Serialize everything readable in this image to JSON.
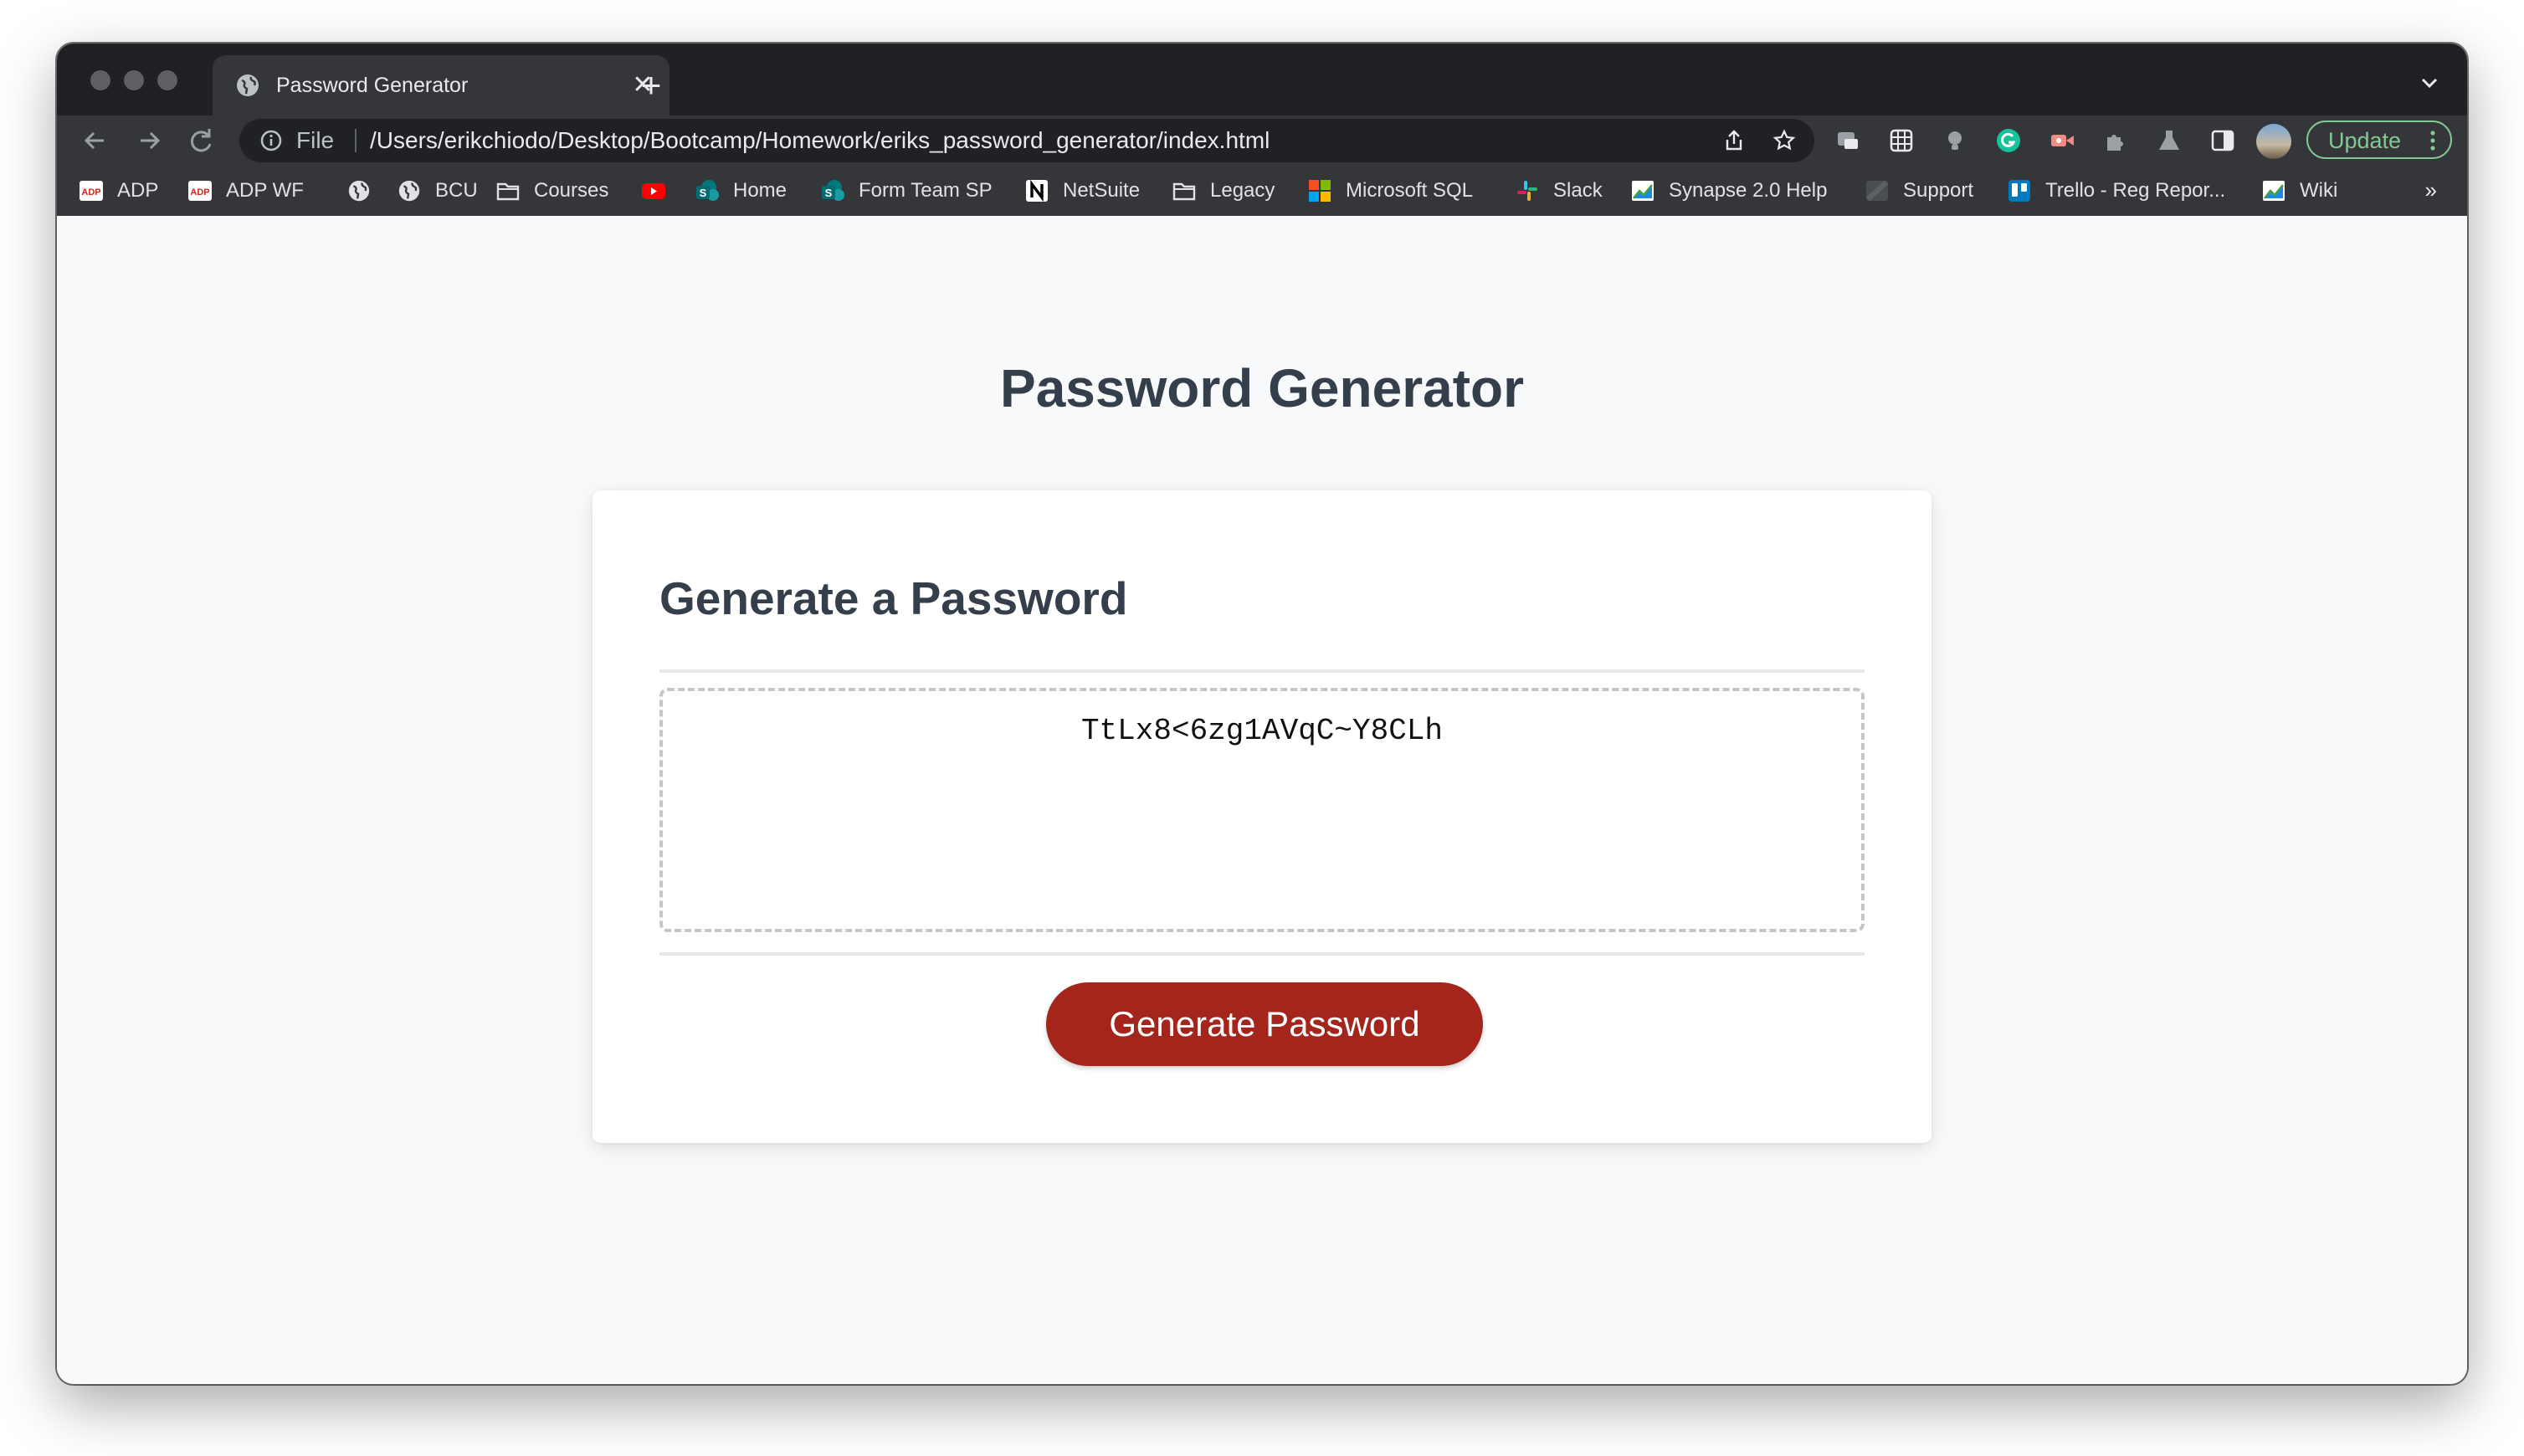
{
  "browser": {
    "tab": {
      "title": "Password Generator"
    },
    "omnibox": {
      "scheme_label": "File",
      "url": "/Users/erikchiodo/Desktop/Bootcamp/Homework/eriks_password_generator/index.html"
    },
    "update_label": "Update",
    "bookmarks": [
      {
        "label": "ADP",
        "icon": "adp-icon"
      },
      {
        "label": "ADP WF",
        "icon": "adp-icon"
      },
      {
        "label": "",
        "icon": "globe-icon"
      },
      {
        "label": "BCU",
        "icon": "globe-icon"
      },
      {
        "label": "Courses",
        "icon": "folder-icon"
      },
      {
        "label": "",
        "icon": "youtube-icon"
      },
      {
        "label": "Home",
        "icon": "sharepoint-icon"
      },
      {
        "label": "Form Team SP",
        "icon": "sharepoint-icon"
      },
      {
        "label": "NetSuite",
        "icon": "netsuite-icon"
      },
      {
        "label": "Legacy",
        "icon": "folder-icon"
      },
      {
        "label": "Microsoft SQL",
        "icon": "microsoft-icon"
      },
      {
        "label": "Slack",
        "icon": "slack-icon"
      },
      {
        "label": "Synapse 2.0 Help",
        "icon": "chart-icon"
      },
      {
        "label": "Support",
        "icon": "support-icon"
      },
      {
        "label": "Trello - Reg Repor...",
        "icon": "trello-icon"
      },
      {
        "label": "Wiki",
        "icon": "chart-icon"
      }
    ],
    "bookmarks_overflow": "»"
  },
  "page": {
    "title": "Password Generator",
    "card": {
      "header": "Generate a Password",
      "password": "TtLx8<6zg1AVqC~Y8CLh",
      "button_label": "Generate Password"
    }
  },
  "colors": {
    "button": "#a4251c",
    "heading": "#353f4b",
    "chrome_dark": "#202124",
    "chrome_toolbar": "#35363a",
    "update_accent": "#81c995"
  }
}
